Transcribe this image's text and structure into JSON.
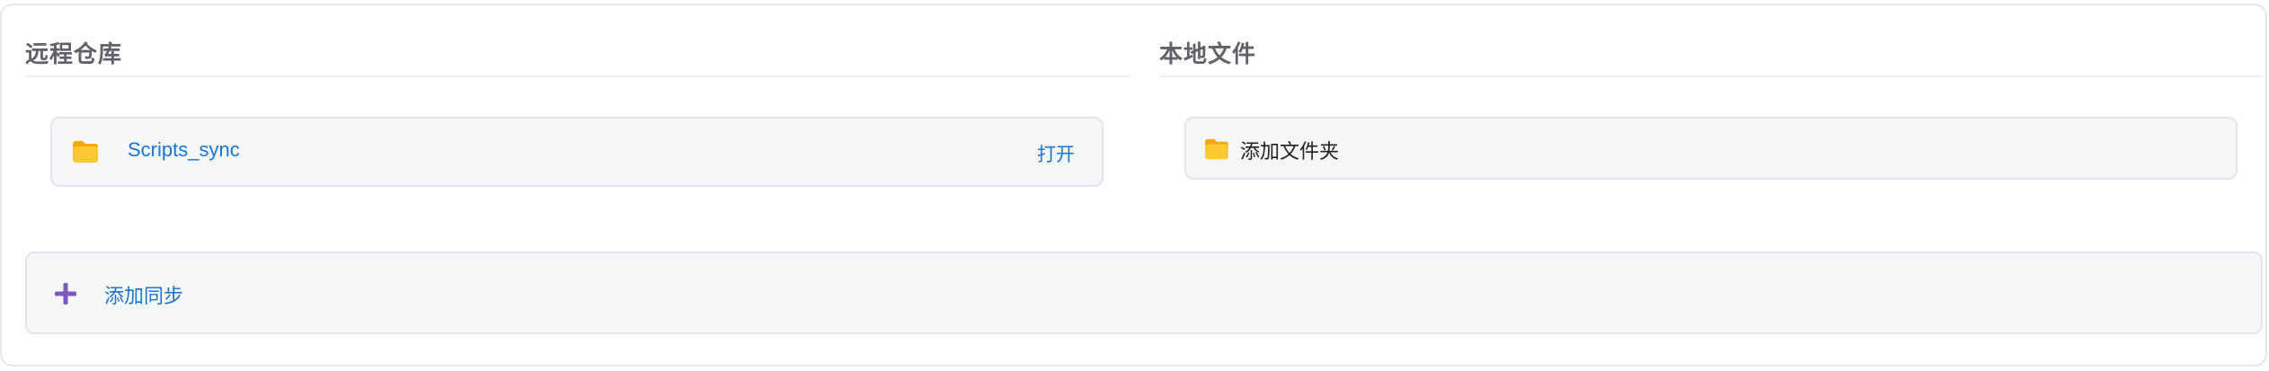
{
  "remote": {
    "title": "远程仓库",
    "repo": {
      "name": "Scripts_sync",
      "open_label": "打开",
      "icon": "folder-icon"
    }
  },
  "local": {
    "title": "本地文件",
    "add_folder_label": "添加文件夹",
    "icon": "folder-icon"
  },
  "add_sync": {
    "label": "添加同步",
    "icon": "plus-icon"
  },
  "colors": {
    "link": "#1976d2",
    "folder": "#fbc02d",
    "plus": "#7e57c2",
    "card_bg": "#f6f7f9",
    "border": "#e2e5e9"
  }
}
